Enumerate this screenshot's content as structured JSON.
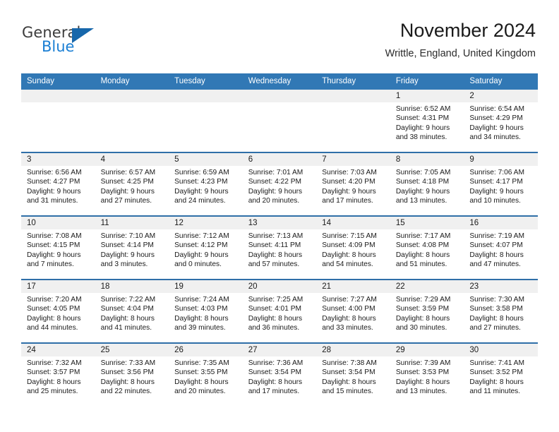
{
  "brand": {
    "name_top": "General",
    "name_bottom": "Blue",
    "accent_color": "#1767ab",
    "blue_text_color": "#1b7fd4"
  },
  "header": {
    "title": "November 2024",
    "subtitle": "Writtle, England, United Kingdom"
  },
  "calendar": {
    "header_bg": "#3178b5",
    "day_strip_bg": "#f0f0f0",
    "row_border_color": "#2f6fa8",
    "weekday_headers": [
      "Sunday",
      "Monday",
      "Tuesday",
      "Wednesday",
      "Thursday",
      "Friday",
      "Saturday"
    ],
    "weeks": [
      [
        {
          "date": ""
        },
        {
          "date": ""
        },
        {
          "date": ""
        },
        {
          "date": ""
        },
        {
          "date": ""
        },
        {
          "date": "1",
          "sunrise": "Sunrise: 6:52 AM",
          "sunset": "Sunset: 4:31 PM",
          "daylight": "Daylight: 9 hours and 38 minutes."
        },
        {
          "date": "2",
          "sunrise": "Sunrise: 6:54 AM",
          "sunset": "Sunset: 4:29 PM",
          "daylight": "Daylight: 9 hours and 34 minutes."
        }
      ],
      [
        {
          "date": "3",
          "sunrise": "Sunrise: 6:56 AM",
          "sunset": "Sunset: 4:27 PM",
          "daylight": "Daylight: 9 hours and 31 minutes."
        },
        {
          "date": "4",
          "sunrise": "Sunrise: 6:57 AM",
          "sunset": "Sunset: 4:25 PM",
          "daylight": "Daylight: 9 hours and 27 minutes."
        },
        {
          "date": "5",
          "sunrise": "Sunrise: 6:59 AM",
          "sunset": "Sunset: 4:23 PM",
          "daylight": "Daylight: 9 hours and 24 minutes."
        },
        {
          "date": "6",
          "sunrise": "Sunrise: 7:01 AM",
          "sunset": "Sunset: 4:22 PM",
          "daylight": "Daylight: 9 hours and 20 minutes."
        },
        {
          "date": "7",
          "sunrise": "Sunrise: 7:03 AM",
          "sunset": "Sunset: 4:20 PM",
          "daylight": "Daylight: 9 hours and 17 minutes."
        },
        {
          "date": "8",
          "sunrise": "Sunrise: 7:05 AM",
          "sunset": "Sunset: 4:18 PM",
          "daylight": "Daylight: 9 hours and 13 minutes."
        },
        {
          "date": "9",
          "sunrise": "Sunrise: 7:06 AM",
          "sunset": "Sunset: 4:17 PM",
          "daylight": "Daylight: 9 hours and 10 minutes."
        }
      ],
      [
        {
          "date": "10",
          "sunrise": "Sunrise: 7:08 AM",
          "sunset": "Sunset: 4:15 PM",
          "daylight": "Daylight: 9 hours and 7 minutes."
        },
        {
          "date": "11",
          "sunrise": "Sunrise: 7:10 AM",
          "sunset": "Sunset: 4:14 PM",
          "daylight": "Daylight: 9 hours and 3 minutes."
        },
        {
          "date": "12",
          "sunrise": "Sunrise: 7:12 AM",
          "sunset": "Sunset: 4:12 PM",
          "daylight": "Daylight: 9 hours and 0 minutes."
        },
        {
          "date": "13",
          "sunrise": "Sunrise: 7:13 AM",
          "sunset": "Sunset: 4:11 PM",
          "daylight": "Daylight: 8 hours and 57 minutes."
        },
        {
          "date": "14",
          "sunrise": "Sunrise: 7:15 AM",
          "sunset": "Sunset: 4:09 PM",
          "daylight": "Daylight: 8 hours and 54 minutes."
        },
        {
          "date": "15",
          "sunrise": "Sunrise: 7:17 AM",
          "sunset": "Sunset: 4:08 PM",
          "daylight": "Daylight: 8 hours and 51 minutes."
        },
        {
          "date": "16",
          "sunrise": "Sunrise: 7:19 AM",
          "sunset": "Sunset: 4:07 PM",
          "daylight": "Daylight: 8 hours and 47 minutes."
        }
      ],
      [
        {
          "date": "17",
          "sunrise": "Sunrise: 7:20 AM",
          "sunset": "Sunset: 4:05 PM",
          "daylight": "Daylight: 8 hours and 44 minutes."
        },
        {
          "date": "18",
          "sunrise": "Sunrise: 7:22 AM",
          "sunset": "Sunset: 4:04 PM",
          "daylight": "Daylight: 8 hours and 41 minutes."
        },
        {
          "date": "19",
          "sunrise": "Sunrise: 7:24 AM",
          "sunset": "Sunset: 4:03 PM",
          "daylight": "Daylight: 8 hours and 39 minutes."
        },
        {
          "date": "20",
          "sunrise": "Sunrise: 7:25 AM",
          "sunset": "Sunset: 4:01 PM",
          "daylight": "Daylight: 8 hours and 36 minutes."
        },
        {
          "date": "21",
          "sunrise": "Sunrise: 7:27 AM",
          "sunset": "Sunset: 4:00 PM",
          "daylight": "Daylight: 8 hours and 33 minutes."
        },
        {
          "date": "22",
          "sunrise": "Sunrise: 7:29 AM",
          "sunset": "Sunset: 3:59 PM",
          "daylight": "Daylight: 8 hours and 30 minutes."
        },
        {
          "date": "23",
          "sunrise": "Sunrise: 7:30 AM",
          "sunset": "Sunset: 3:58 PM",
          "daylight": "Daylight: 8 hours and 27 minutes."
        }
      ],
      [
        {
          "date": "24",
          "sunrise": "Sunrise: 7:32 AM",
          "sunset": "Sunset: 3:57 PM",
          "daylight": "Daylight: 8 hours and 25 minutes."
        },
        {
          "date": "25",
          "sunrise": "Sunrise: 7:33 AM",
          "sunset": "Sunset: 3:56 PM",
          "daylight": "Daylight: 8 hours and 22 minutes."
        },
        {
          "date": "26",
          "sunrise": "Sunrise: 7:35 AM",
          "sunset": "Sunset: 3:55 PM",
          "daylight": "Daylight: 8 hours and 20 minutes."
        },
        {
          "date": "27",
          "sunrise": "Sunrise: 7:36 AM",
          "sunset": "Sunset: 3:54 PM",
          "daylight": "Daylight: 8 hours and 17 minutes."
        },
        {
          "date": "28",
          "sunrise": "Sunrise: 7:38 AM",
          "sunset": "Sunset: 3:54 PM",
          "daylight": "Daylight: 8 hours and 15 minutes."
        },
        {
          "date": "29",
          "sunrise": "Sunrise: 7:39 AM",
          "sunset": "Sunset: 3:53 PM",
          "daylight": "Daylight: 8 hours and 13 minutes."
        },
        {
          "date": "30",
          "sunrise": "Sunrise: 7:41 AM",
          "sunset": "Sunset: 3:52 PM",
          "daylight": "Daylight: 8 hours and 11 minutes."
        }
      ]
    ]
  }
}
